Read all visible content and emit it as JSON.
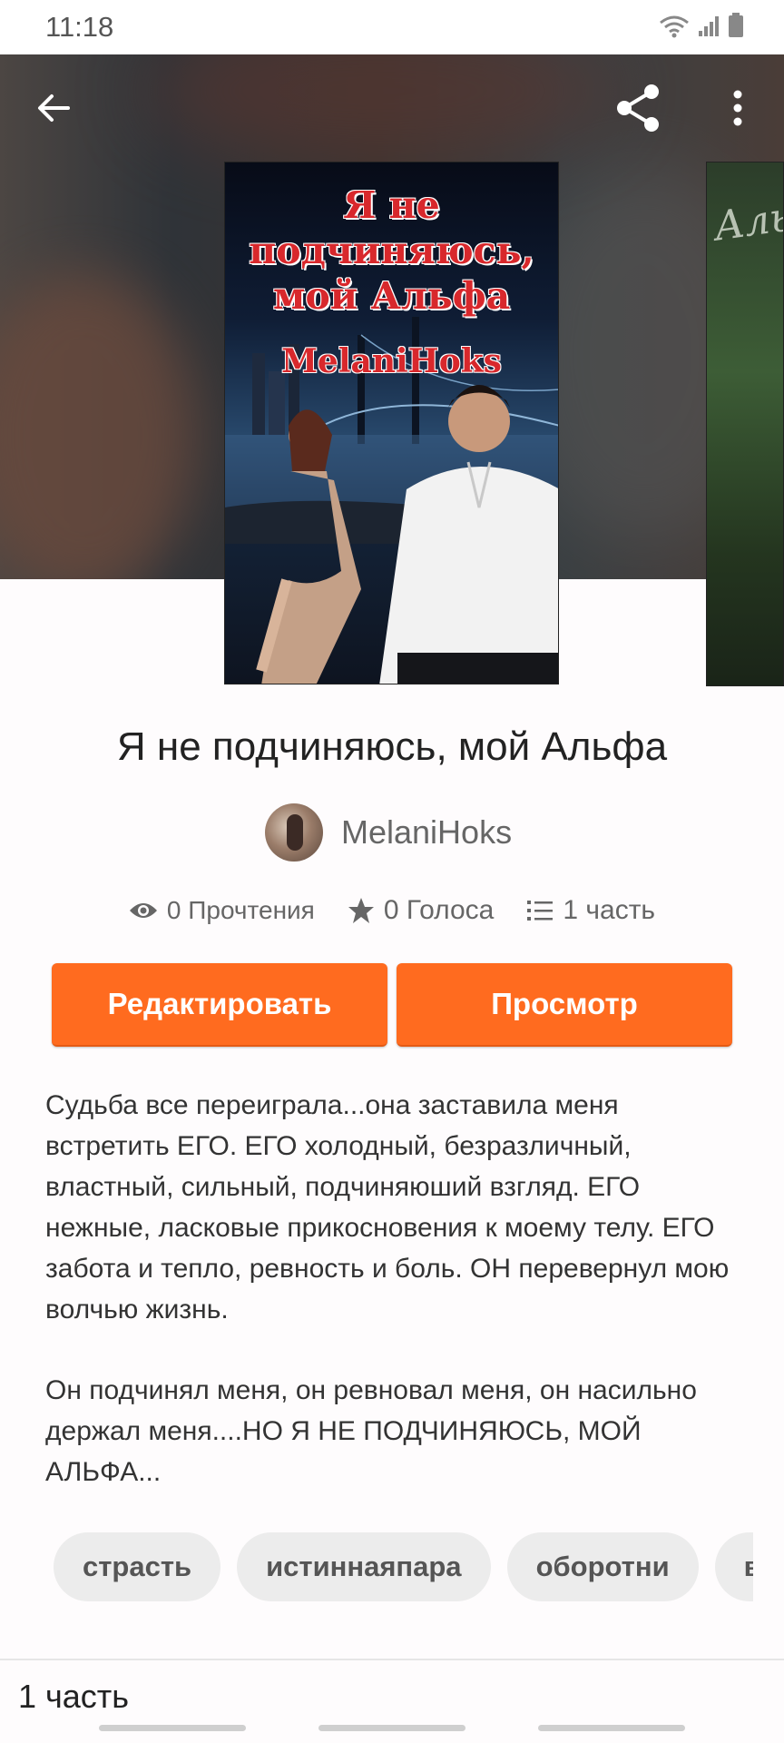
{
  "status_bar": {
    "time": "11:18"
  },
  "icons": {
    "back": "arrow-left-icon",
    "share": "share-icon",
    "more": "more-vertical-icon",
    "views": "eye-icon",
    "votes": "star-icon",
    "parts": "list-icon"
  },
  "cover": {
    "title_line1": "Я не",
    "title_line2": "подчиняюсь,",
    "title_line3": "мой Альфа",
    "author": "MelaniHoks",
    "next_cover_text": "Аль"
  },
  "story": {
    "title": "Я не подчиняюсь, мой Альфа",
    "author": "MelaniHoks",
    "reads": "0 Прочтения",
    "votes": "0 Голоса",
    "parts": "1 часть"
  },
  "buttons": {
    "edit": "Редактировать",
    "preview": "Просмотр"
  },
  "description": {
    "paragraph1": "Судьба все переиграла...она заставила меня встретить ЕГО. ЕГО холодный, безразличный, властный, сильный, подчиняюший взгляд. ЕГО нежные, ласковые прикосновения к моему телу. ЕГО забота и тепло, ревность и боль. ОН перевернул мою волчью жизнь.",
    "paragraph2": "Он подчинял меня, он ревновал меня, он насильно держал меня....НО Я НЕ ПОДЧИНЯЮСЬ, МОЙ АЛЬФА..."
  },
  "tags": [
    "страсть",
    "истиннаяпара",
    "оборотни",
    "во"
  ],
  "parts_section": {
    "heading": "1 часть"
  },
  "colors": {
    "accent": "#ff6b1f",
    "tag_bg": "#ececec",
    "cover_title": "#d8282c"
  }
}
